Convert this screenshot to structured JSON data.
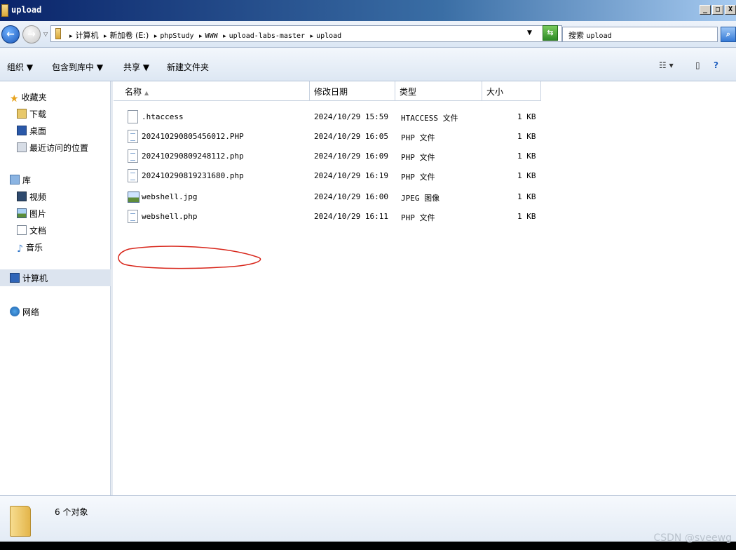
{
  "window": {
    "title": "upload",
    "min_label": "_",
    "max_label": "□",
    "close_label": "X"
  },
  "address": {
    "crumbs": [
      "计算机",
      "新加卷 (E:)",
      "phpStudy",
      "WWW",
      "upload-labs-master",
      "upload"
    ],
    "search_placeholder_prefix": "搜索",
    "search_placeholder_query": "upload"
  },
  "toolbar": {
    "organize": "组织 ▼",
    "include_library": "包含到库中 ▼",
    "share": "共享 ▼",
    "new_folder": "新建文件夹"
  },
  "sidebar": {
    "favorites": "收藏夹",
    "downloads": "下载",
    "desktop": "桌面",
    "recent": "最近访问的位置",
    "libraries": "库",
    "videos": "视频",
    "pictures": "图片",
    "documents": "文档",
    "music": "音乐",
    "computer": "计算机",
    "network": "网络"
  },
  "columns": {
    "name": "名称",
    "modified": "修改日期",
    "type": "类型",
    "size": "大小"
  },
  "files": [
    {
      "name": ".htaccess",
      "modified": "2024/10/29 15:59",
      "type": "HTACCESS 文件",
      "size": "1 KB",
      "icon": "blank-file-icon"
    },
    {
      "name": "202410290805456012.PHP",
      "modified": "2024/10/29 16:05",
      "type": "PHP 文件",
      "size": "1 KB",
      "icon": "php-file-icon"
    },
    {
      "name": "202410290809248112.php",
      "modified": "2024/10/29 16:09",
      "type": "PHP 文件",
      "size": "1 KB",
      "icon": "php-file-icon"
    },
    {
      "name": "202410290819231680.php",
      "modified": "2024/10/29 16:19",
      "type": "PHP 文件",
      "size": "1 KB",
      "icon": "php-file-icon"
    },
    {
      "name": "webshell.jpg",
      "modified": "2024/10/29 16:00",
      "type": "JPEG 图像",
      "size": "1 KB",
      "icon": "image-file-icon"
    },
    {
      "name": "webshell.php",
      "modified": "2024/10/29 16:11",
      "type": "PHP 文件",
      "size": "1 KB",
      "icon": "php-file-icon"
    }
  ],
  "status": {
    "count_text": "6 个对象"
  },
  "watermark": "CSDN @sveewg",
  "colors": {
    "annotation_circle": "#d8261b",
    "selected_nav": "#dce4ef"
  }
}
